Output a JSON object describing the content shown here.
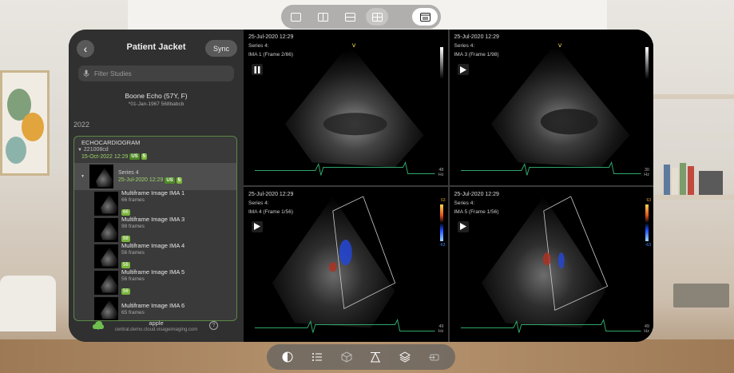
{
  "layout_bar": {
    "buttons": [
      {
        "name": "layout-1x1",
        "active": false
      },
      {
        "name": "layout-1x2",
        "active": false
      },
      {
        "name": "layout-2x1",
        "active": false
      },
      {
        "name": "layout-2x2",
        "active": true
      },
      {
        "name": "layout-menu",
        "active": false
      }
    ]
  },
  "sidebar": {
    "title": "Patient Jacket",
    "sync_label": "Sync",
    "back_icon": "chevron-left-icon",
    "search_placeholder": "Filter Studies",
    "patient": {
      "name": "Boone Echo (57Y, F)",
      "details": "*01-Jan-1967  568babcb"
    },
    "year": "2022",
    "study": {
      "type": "ECHOCARDIOGRAM",
      "id": "221008cd",
      "date": "15-Oct-2022 12:29",
      "modality": "US",
      "count": "5"
    },
    "series": {
      "name": "Series 4",
      "date": "25-Jul-2020 12:29",
      "modality": "US",
      "count": "5"
    },
    "images": [
      {
        "title": "Multiframe Image IMA 1",
        "frames": "66 frames",
        "badge": "66"
      },
      {
        "title": "Multiframe Image IMA 3",
        "frames": "98 frames",
        "badge": "98"
      },
      {
        "title": "Multiframe Image IMA 4",
        "frames": "56 frames",
        "badge": "56"
      },
      {
        "title": "Multiframe Image IMA 5",
        "frames": "56 frames",
        "badge": "56"
      },
      {
        "title": "Multiframe Image IMA 6",
        "frames": "65 frames",
        "badge": ""
      }
    ],
    "footer": {
      "server_name": "apple",
      "server_url": "central.demo.cloud.visageimaging.com",
      "help": "?"
    }
  },
  "viewports": [
    {
      "date": "25-Jul-2020 12:29",
      "series": "Series 4:",
      "ima": "IMA 1 (Frame 2/66)",
      "control": "pause",
      "hz_top": "48",
      "hz_bot": "Hz",
      "doppler": false
    },
    {
      "date": "25-Jul-2020 12:29",
      "series": "Series 4:",
      "ima": "IMA 3 (Frame 1/98)",
      "control": "play",
      "hz_top": "30",
      "hz_bot": "Hz",
      "doppler": false
    },
    {
      "date": "25-Jul-2020 12:29",
      "series": "Series 4:",
      "ima": "IMA 4 (Frame 1/56)",
      "control": "play",
      "hz_top": "49",
      "hz_bot": "Hz",
      "doppler": true,
      "scale_top": "63",
      "scale_bot": "-63"
    },
    {
      "date": "25-Jul-2020 12:29",
      "series": "Series 4:",
      "ima": "IMA 5 (Frame 1/56)",
      "control": "play",
      "hz_top": "49",
      "hz_bot": "Hz",
      "doppler": true,
      "scale_top": "63",
      "scale_bot": "-63"
    }
  ],
  "tool_bar": {
    "tools": [
      "contrast-icon",
      "list-icon",
      "cube-icon",
      "measure-icon",
      "layers-icon",
      "exit-icon"
    ]
  },
  "colors": {
    "accent_green": "#7ab53b",
    "window_bg": "#000000"
  }
}
